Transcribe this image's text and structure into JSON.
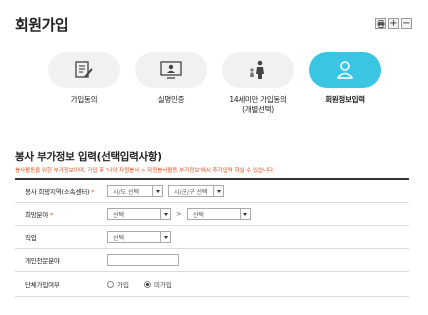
{
  "page": {
    "title": "회원가입"
  },
  "toolbar": {
    "plus": "+",
    "minus": "−"
  },
  "steps": [
    {
      "label": "가입동의",
      "icon": "document-pen-icon"
    },
    {
      "label": "실명인증",
      "icon": "monitor-person-icon"
    },
    {
      "label": "14세미만 가입동의\n(개별선택)",
      "icon": "parent-child-icon"
    },
    {
      "label": "회원정보입력",
      "icon": "user-info-icon",
      "active": true
    }
  ],
  "section": {
    "title": "봉사 부가정보 입력(선택입력사항)",
    "notice": "봉사활동을 위한 부가정보이며, 가입 후 '나의 자원봉사 > 자원봉사활동 부가정보'에서 추가입력 하실 수 있습니다."
  },
  "form": {
    "region": {
      "label": "봉사 희망지역(소속센터)",
      "required": "*",
      "sido": "시/도 선택",
      "gugun": "시/군/구 선택"
    },
    "field": {
      "label": "희망분야",
      "required": "*",
      "first": "선택",
      "sep": ">",
      "second": "선택"
    },
    "job": {
      "label": "직업",
      "value": "선택"
    },
    "expertise": {
      "label": "개인전문분야",
      "value": ""
    },
    "group": {
      "label": "단체가입여부",
      "yes": "가입",
      "no": "미가입",
      "selected": "미가입"
    }
  },
  "colors": {
    "accent": "#39c6e2",
    "notice": "#e0521f"
  }
}
